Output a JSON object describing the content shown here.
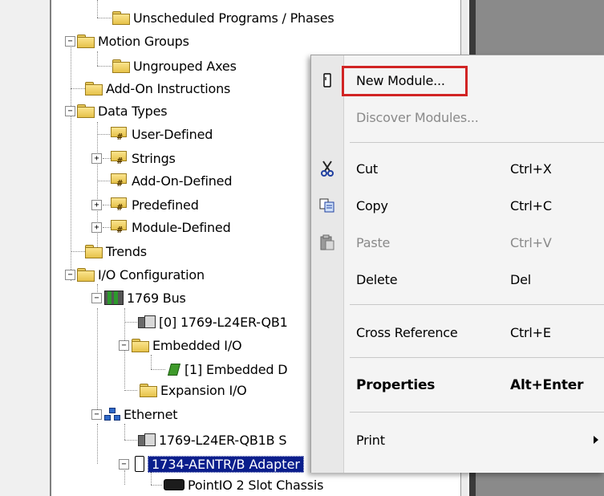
{
  "tree": {
    "items": [
      {
        "label": "Unscheduled Programs / Phases"
      },
      {
        "label": "Motion Groups"
      },
      {
        "label": "Ungrouped Axes"
      },
      {
        "label": "Add-On Instructions"
      },
      {
        "label": "Data Types"
      },
      {
        "label": "User-Defined"
      },
      {
        "label": "Strings"
      },
      {
        "label": "Add-On-Defined"
      },
      {
        "label": "Predefined"
      },
      {
        "label": "Module-Defined"
      },
      {
        "label": "Trends"
      },
      {
        "label": "I/O Configuration"
      },
      {
        "label": "1769 Bus"
      },
      {
        "label": "[0] 1769-L24ER-QB1"
      },
      {
        "label": "Embedded I/O"
      },
      {
        "label": "[1] Embedded D"
      },
      {
        "label": "Expansion I/O"
      },
      {
        "label": "Ethernet"
      },
      {
        "label": "1769-L24ER-QB1B S"
      },
      {
        "label": "1734-AENTR/B Adapter"
      },
      {
        "label": "PointIO 2 Slot Chassis"
      }
    ]
  },
  "context_menu": {
    "items": [
      {
        "label": "New Module...",
        "shortcut": "",
        "icon": "new-module-icon",
        "disabled": false
      },
      {
        "label": "Discover Modules...",
        "shortcut": "",
        "icon": "",
        "disabled": true
      },
      {
        "label": "Cut",
        "shortcut": "Ctrl+X",
        "icon": "scissors-icon",
        "disabled": false
      },
      {
        "label": "Copy",
        "shortcut": "Ctrl+C",
        "icon": "copy-icon",
        "disabled": false
      },
      {
        "label": "Paste",
        "shortcut": "Ctrl+V",
        "icon": "paste-icon",
        "disabled": true
      },
      {
        "label": "Delete",
        "shortcut": "Del",
        "icon": "",
        "disabled": false
      },
      {
        "label": "Cross Reference",
        "shortcut": "Ctrl+E",
        "icon": "",
        "disabled": false
      },
      {
        "label": "Properties",
        "shortcut": "Alt+Enter",
        "icon": "",
        "disabled": false
      },
      {
        "label": "Print",
        "shortcut": "",
        "icon": "",
        "disabled": false,
        "submenu": true
      }
    ]
  },
  "colors": {
    "selection": "#0a1e8c",
    "highlight_box": "#d12424"
  }
}
